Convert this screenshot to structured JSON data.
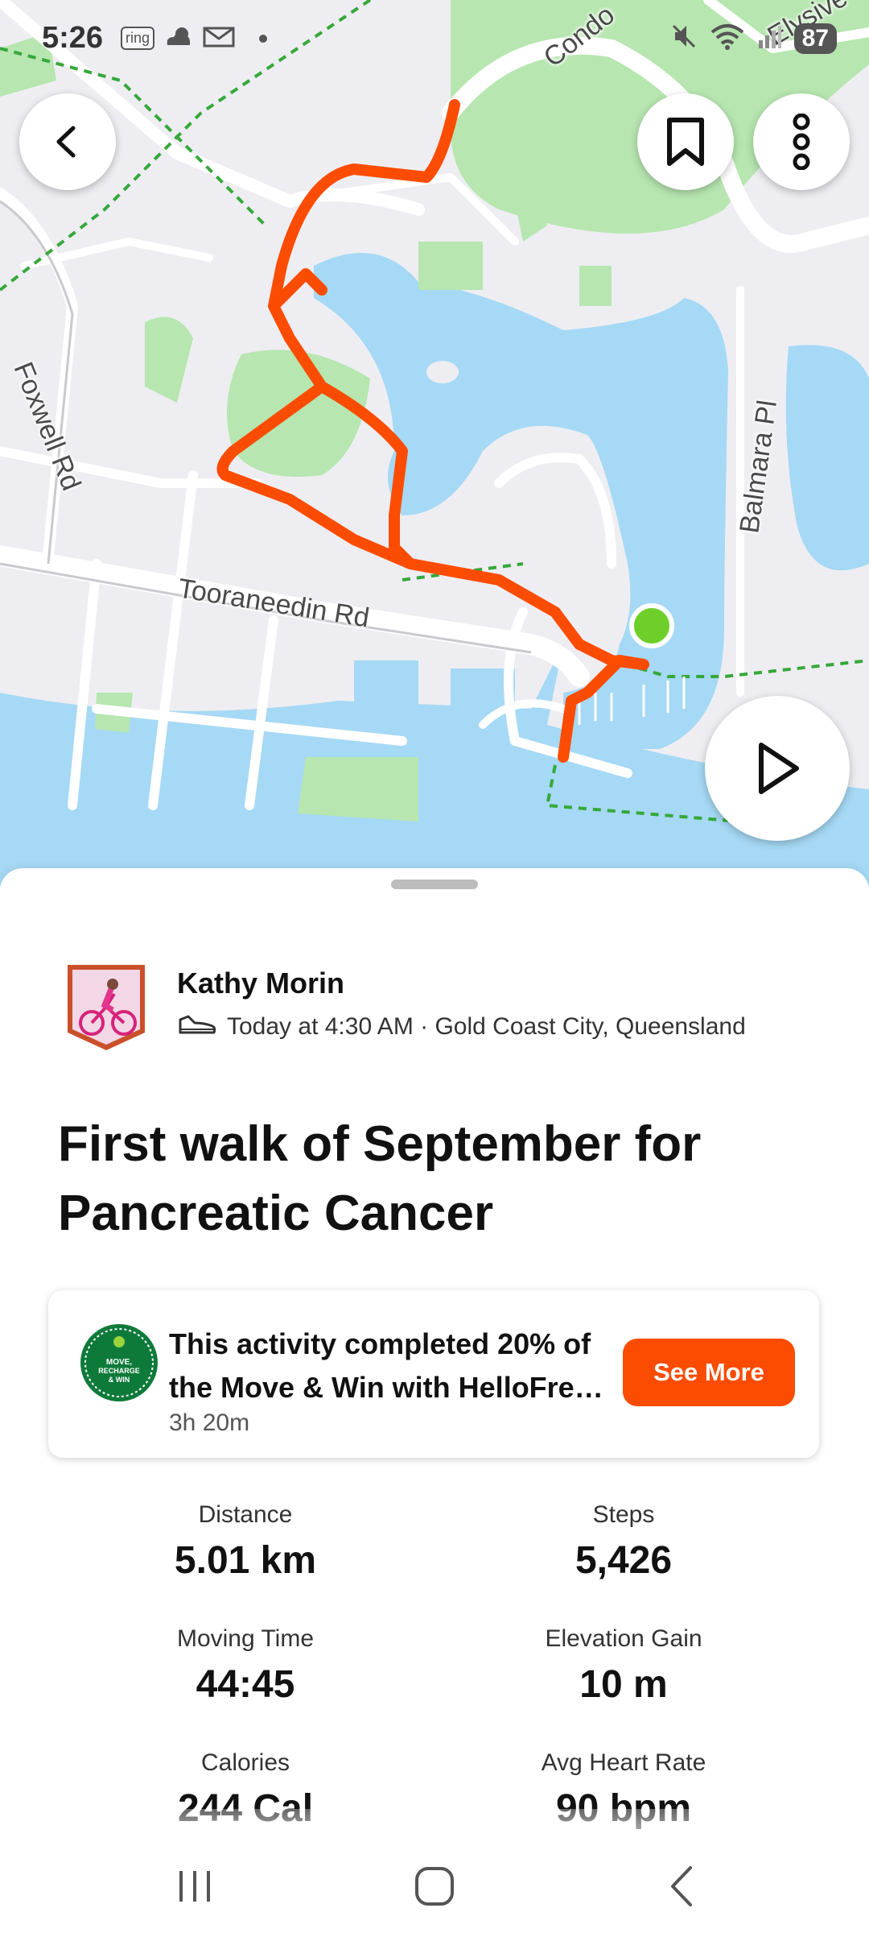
{
  "status_bar": {
    "time": "5:26",
    "ring_label": "ring",
    "battery": "87",
    "icons": [
      "ring-icon",
      "weather-icon",
      "mail-icon",
      "dot-icon",
      "mute-icon",
      "wifi-icon",
      "signal-icon",
      "battery-icon"
    ]
  },
  "map": {
    "labels": {
      "condo": "Condo",
      "elysive": "Elysive",
      "foxwell": "Foxwell Rd",
      "tooraneedin": "Tooraneedin Rd",
      "balmara": "Balmara Pl"
    },
    "route_color": "#fc4c02",
    "end_marker_color": "#6fcf2a",
    "water_color": "#a6d9f5",
    "park_color": "#b7e6b0"
  },
  "athlete": {
    "name": "Kathy Morin",
    "meta": "Today at 4:30 AM · Gold Coast City, Queensland"
  },
  "activity": {
    "title": "First walk of September for Pancreatic Cancer"
  },
  "challenge": {
    "line1": "This activity completed 20% of",
    "line2": "the Move & Win with HelloFre…",
    "duration": "3h 20m",
    "button": "See More",
    "badge_text": "MOVE, RECHARGE & WIN"
  },
  "stats": [
    {
      "label": "Distance",
      "value": "5.01 km"
    },
    {
      "label": "Steps",
      "value": "5,426"
    },
    {
      "label": "Moving Time",
      "value": "44:45"
    },
    {
      "label": "Elevation Gain",
      "value": "10 m"
    },
    {
      "label": "Calories",
      "value": "244 Cal"
    },
    {
      "label": "Avg Heart Rate",
      "value": "90 bpm"
    }
  ],
  "colors": {
    "accent": "#fc4c02"
  }
}
